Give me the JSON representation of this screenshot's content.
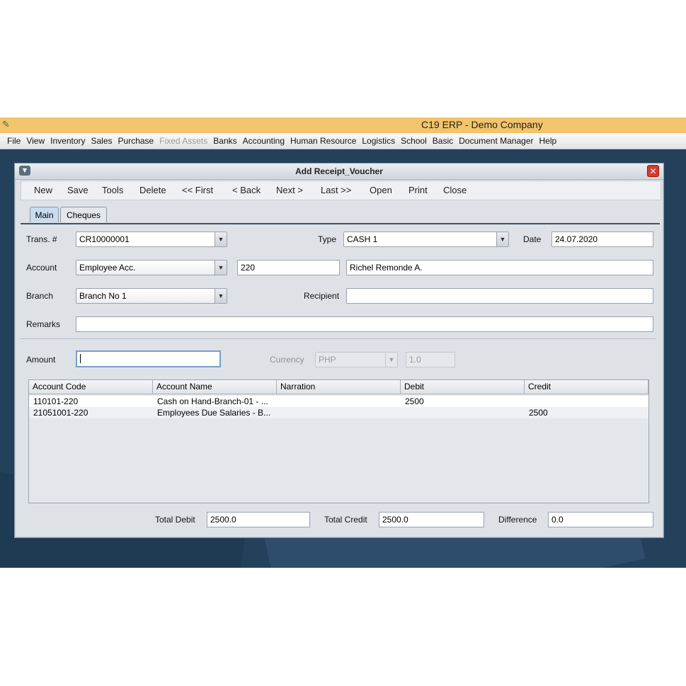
{
  "app": {
    "title": "C19 ERP - Demo Company",
    "logo_glyph": "✎",
    "menu": [
      {
        "label": "File",
        "enabled": true
      },
      {
        "label": "View",
        "enabled": true
      },
      {
        "label": "Inventory",
        "enabled": true
      },
      {
        "label": "Sales",
        "enabled": true
      },
      {
        "label": "Purchase",
        "enabled": true
      },
      {
        "label": "Fixed Assets",
        "enabled": false
      },
      {
        "label": "Banks",
        "enabled": true
      },
      {
        "label": "Accounting",
        "enabled": true
      },
      {
        "label": "Human Resource",
        "enabled": true
      },
      {
        "label": "Logistics",
        "enabled": true
      },
      {
        "label": "School",
        "enabled": true
      },
      {
        "label": "Basic",
        "enabled": true
      },
      {
        "label": "Document Manager",
        "enabled": true
      },
      {
        "label": "Help",
        "enabled": true
      }
    ]
  },
  "window": {
    "title": "Add Receipt_Voucher",
    "menu_glyph": "▼",
    "close_glyph": "✕"
  },
  "toolbar": {
    "new": "New",
    "save": "Save",
    "tools": "Tools",
    "delete": "Delete",
    "first": "<< First",
    "back": "< Back",
    "next": "Next >",
    "last": "Last >>",
    "open": "Open",
    "print": "Print",
    "close": "Close"
  },
  "tabs": {
    "main": "Main",
    "cheques": "Cheques",
    "active": "Main"
  },
  "form": {
    "trans_label": "Trans. #",
    "trans_value": "CR10000001",
    "type_label": "Type",
    "type_value": "CASH 1",
    "date_label": "Date",
    "date_value": "24.07.2020",
    "account_label": "Account",
    "account_value": "Employee Acc.",
    "account_code": "220",
    "account_name": "Richel Remonde A.",
    "branch_label": "Branch",
    "branch_value": "Branch No 1",
    "recipient_label": "Recipient",
    "recipient_value": "",
    "remarks_label": "Remarks",
    "remarks_value": "",
    "amount_label": "Amount",
    "amount_value": "",
    "currency_label": "Currency",
    "currency_value": "PHP",
    "rate_value": "1.0",
    "dropdown_glyph": "▼"
  },
  "table": {
    "columns": [
      "Account Code",
      "Account Name",
      "Narration",
      "Debit",
      "Credit"
    ],
    "rows": [
      {
        "account_code": "110101-220",
        "account_name": "Cash on Hand-Branch-01 - ...",
        "narration": "",
        "debit": "2500",
        "credit": ""
      },
      {
        "account_code": "21051001-220",
        "account_name": "Employees Due Salaries - B...",
        "narration": "",
        "debit": "",
        "credit": "2500"
      }
    ]
  },
  "totals": {
    "total_debit_label": "Total Debit",
    "total_debit_value": "2500.0",
    "total_credit_label": "Total Credit",
    "total_credit_value": "2500.0",
    "difference_label": "Difference",
    "difference_value": "0.0"
  }
}
